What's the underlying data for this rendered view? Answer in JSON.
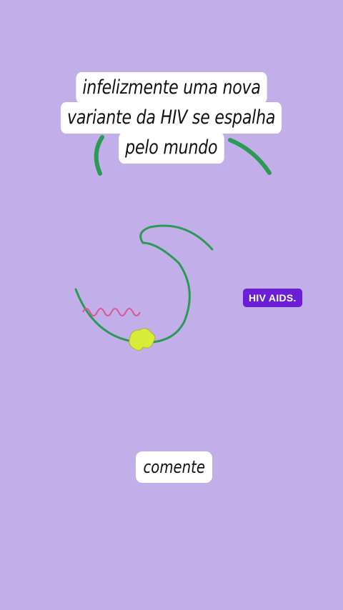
{
  "caption": {
    "lines": [
      "infelizmente uma nova",
      "variante da HIV se espalha",
      "pelo mundo"
    ]
  },
  "badge": {
    "label": "HIV AIDS."
  },
  "comment": {
    "label": "comente"
  },
  "colors": {
    "background": "#c2afea",
    "caption_bg": "#ffffff",
    "badge_bg": "#6a1fd6",
    "curve_green": "#2a9a55",
    "wavy_pink": "#d9569a",
    "cell_yellow": "#d8ec3a"
  }
}
